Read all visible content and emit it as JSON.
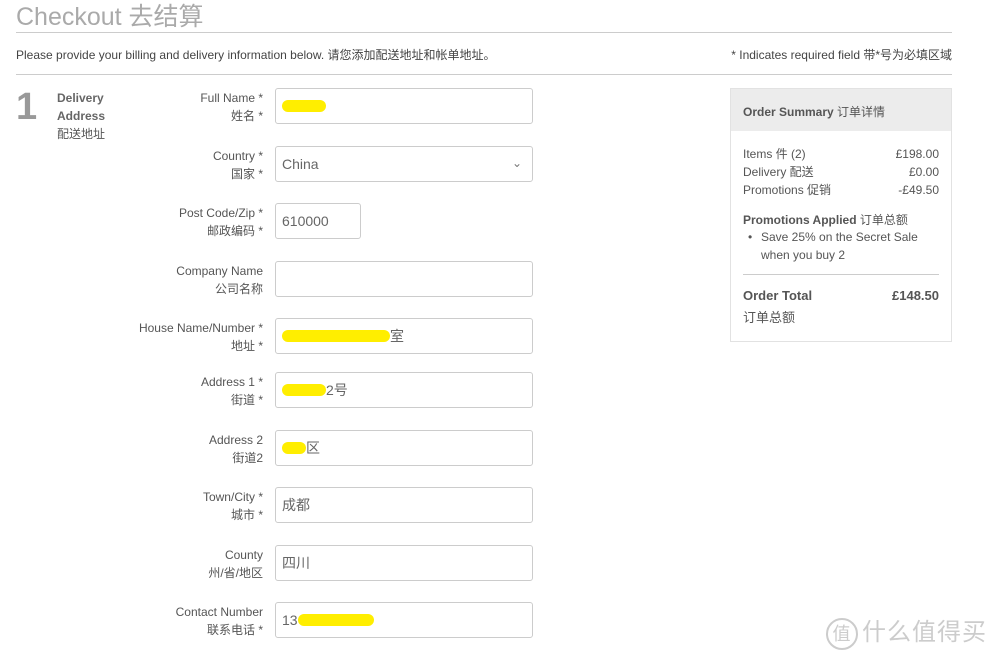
{
  "header": {
    "title": "Checkout 去结算",
    "intro": "Please provide your billing and delivery information below. 请您添加配送地址和帐单地址。",
    "required_note": "* Indicates required field 带*号为必填区域"
  },
  "step": {
    "number": "1",
    "title1": "Delivery",
    "title2": "Address",
    "title_cn": "配送地址"
  },
  "fields": [
    {
      "label": "Full Name *",
      "label_cn": "姓名 *",
      "value": "",
      "redacted": true
    },
    {
      "label": "Country *",
      "label_cn": "国家 *",
      "value": "China",
      "type": "select"
    },
    {
      "label": "Post Code/Zip *",
      "label_cn": "邮政编码 *",
      "value": "610000"
    },
    {
      "label": "Company Name",
      "label_cn": "公司名称",
      "value": ""
    },
    {
      "label": "House Name/Number *",
      "label_cn": "地址 *",
      "value": "室",
      "redacted": true
    },
    {
      "label": "Address 1 *",
      "label_cn": "街道 *",
      "value": "2号",
      "redacted": true
    },
    {
      "label": "Address 2",
      "label_cn": "街道2",
      "value": "区",
      "redacted": true
    },
    {
      "label": "Town/City *",
      "label_cn": "城市 *",
      "value": "成都"
    },
    {
      "label": "County",
      "label_cn": "州/省/地区",
      "value": "四川"
    },
    {
      "label": "Contact Number",
      "label_cn": "联系电话 *",
      "value": "13",
      "redacted": true
    }
  ],
  "summary": {
    "title": "Order Summary",
    "title_cn": "订单详情",
    "lines": [
      {
        "label": "Items 件 (2)",
        "value": "£198.00"
      },
      {
        "label": "Delivery 配送",
        "value": "£0.00"
      },
      {
        "label": "Promotions 促销",
        "value": "-£49.50"
      }
    ],
    "promotions_title": "Promotions Applied",
    "promotions_title_cn": "订单总额",
    "promotions": [
      "Save 25% on the Secret Sale when you buy 2"
    ],
    "total_label": "Order Total",
    "total_value": "£148.50",
    "total_label_cn": "订单总额"
  },
  "watermark": {
    "badge": "值",
    "text": "什么值得买"
  },
  "colors": {
    "redaction": "#ffee00"
  }
}
